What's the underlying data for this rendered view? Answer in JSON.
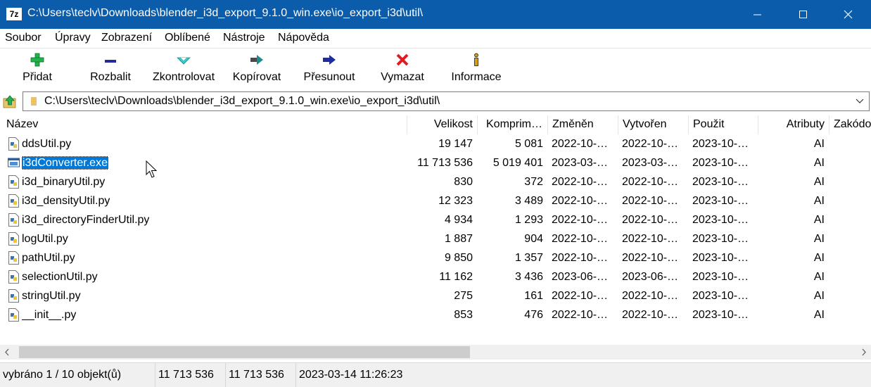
{
  "window": {
    "title": "C:\\Users\\teclv\\Downloads\\blender_i3d_export_9.1.0_win.exe\\io_export_i3d\\util\\",
    "app_icon": "7z"
  },
  "menu": [
    {
      "label": "Soubor"
    },
    {
      "label": "Úpravy"
    },
    {
      "label": "Zobrazení"
    },
    {
      "label": "Oblíbené"
    },
    {
      "label": "Nástroje"
    },
    {
      "label": "Nápověda"
    }
  ],
  "toolbar": [
    {
      "label": "Přidat",
      "icon": "plus-icon",
      "color": "#22b14c"
    },
    {
      "label": "Rozbalit",
      "icon": "minus-icon",
      "color": "#1f2d9c"
    },
    {
      "label": "Zkontrolovat",
      "icon": "check-icon",
      "color": "#3cc8c8"
    },
    {
      "label": "Kopírovat",
      "icon": "copy-arrow-icon",
      "color": "#1e8c8c"
    },
    {
      "label": "Přesunout",
      "icon": "move-arrow-icon",
      "color": "#1f2d9c"
    },
    {
      "label": "Vymazat",
      "icon": "delete-x-icon",
      "color": "#e11b22"
    },
    {
      "label": "Informace",
      "icon": "info-icon",
      "color": "#d4a017"
    }
  ],
  "address": {
    "path": "C:\\Users\\teclv\\Downloads\\blender_i3d_export_9.1.0_win.exe\\io_export_i3d\\util\\"
  },
  "columns": {
    "name": "Název",
    "size": "Velikost",
    "packed": "Komprim…",
    "modified": "Změněn",
    "created": "Vytvořen",
    "accessed": "Použit",
    "attributes": "Atributy",
    "encrypted": "Zakódo"
  },
  "files": [
    {
      "name": "ddsUtil.py",
      "size": "19 147",
      "packed": "5 081",
      "modified": "2022-10-…",
      "created": "2022-10-…",
      "accessed": "2023-10-…",
      "attr": "AI",
      "icon": "python-file-icon"
    },
    {
      "name": "i3dConverter.exe",
      "size": "11 713 536",
      "packed": "5 019 401",
      "modified": "2023-03-…",
      "created": "2023-03-…",
      "accessed": "2023-10-…",
      "attr": "AI",
      "icon": "exe-file-icon",
      "selected": true
    },
    {
      "name": "i3d_binaryUtil.py",
      "size": "830",
      "packed": "372",
      "modified": "2022-10-…",
      "created": "2022-10-…",
      "accessed": "2023-10-…",
      "attr": "AI",
      "icon": "python-file-icon"
    },
    {
      "name": "i3d_densityUtil.py",
      "size": "12 323",
      "packed": "3 489",
      "modified": "2022-10-…",
      "created": "2022-10-…",
      "accessed": "2023-10-…",
      "attr": "AI",
      "icon": "python-file-icon"
    },
    {
      "name": "i3d_directoryFinderUtil.py",
      "size": "4 934",
      "packed": "1 293",
      "modified": "2022-10-…",
      "created": "2022-10-…",
      "accessed": "2023-10-…",
      "attr": "AI",
      "icon": "python-file-icon"
    },
    {
      "name": "logUtil.py",
      "size": "1 887",
      "packed": "904",
      "modified": "2022-10-…",
      "created": "2022-10-…",
      "accessed": "2023-10-…",
      "attr": "AI",
      "icon": "python-file-icon"
    },
    {
      "name": "pathUtil.py",
      "size": "9 850",
      "packed": "1 357",
      "modified": "2022-10-…",
      "created": "2022-10-…",
      "accessed": "2023-10-…",
      "attr": "AI",
      "icon": "python-file-icon"
    },
    {
      "name": "selectionUtil.py",
      "size": "11 162",
      "packed": "3 436",
      "modified": "2023-06-…",
      "created": "2023-06-…",
      "accessed": "2023-10-…",
      "attr": "AI",
      "icon": "python-file-icon"
    },
    {
      "name": "stringUtil.py",
      "size": "275",
      "packed": "161",
      "modified": "2022-10-…",
      "created": "2022-10-…",
      "accessed": "2023-10-…",
      "attr": "AI",
      "icon": "python-file-icon"
    },
    {
      "name": "__init__.py",
      "size": "853",
      "packed": "476",
      "modified": "2022-10-…",
      "created": "2022-10-…",
      "accessed": "2023-10-…",
      "attr": "AI",
      "icon": "python-file-icon"
    }
  ],
  "status": {
    "selection": "vybráno 1 / 10 objekt(ů)",
    "size": "11 713 536",
    "size2": "11 713 536",
    "date": "2023-03-14 11:26:23"
  },
  "colors": {
    "titlebar": "#0b5cab",
    "selection": "#0078d7"
  }
}
